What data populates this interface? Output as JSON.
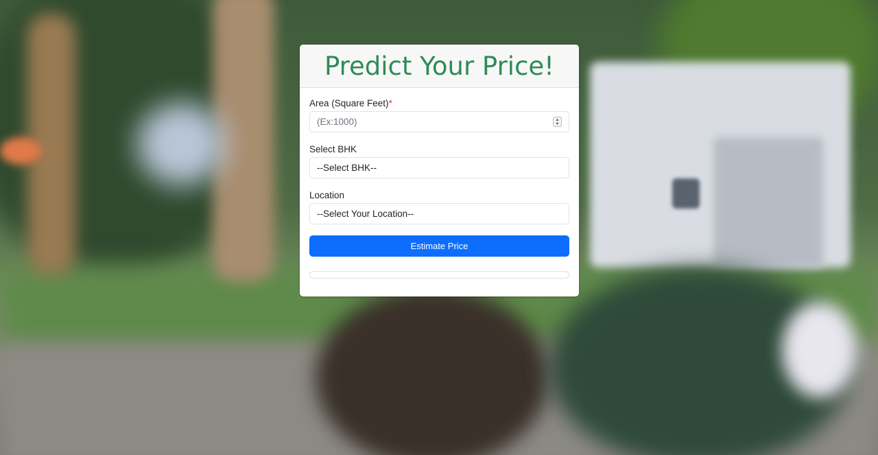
{
  "page": {
    "title": "Predict Your Price!"
  },
  "form": {
    "area": {
      "label": "Area (Square Feet)",
      "required_mark": "*",
      "placeholder": "(Ex:1000)"
    },
    "bhk": {
      "label": "Select BHK",
      "selected": "--Select BHK--"
    },
    "location": {
      "label": "Location",
      "selected": "--Select Your Location--"
    },
    "submit_label": "Estimate Price",
    "result_text": ""
  },
  "colors": {
    "title": "#2e8b57",
    "button": "#0d6efd",
    "required": "#dc3545"
  }
}
